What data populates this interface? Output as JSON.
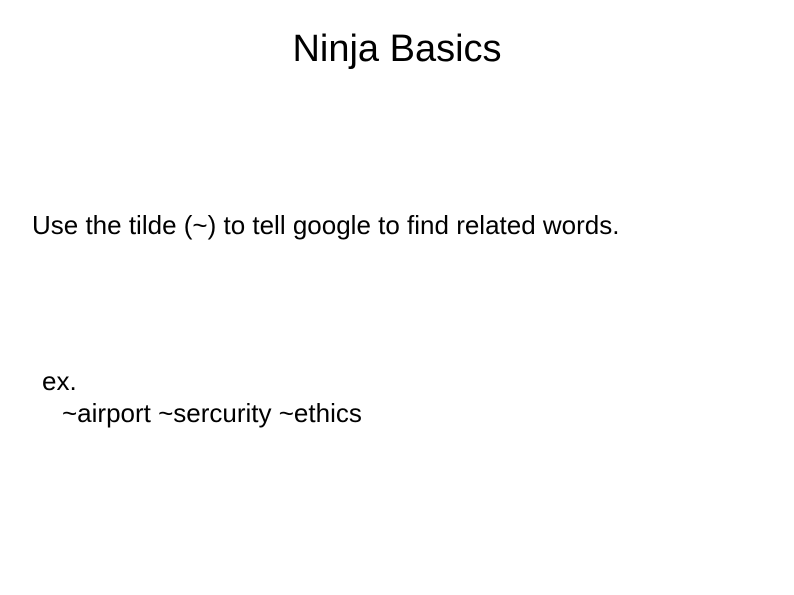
{
  "title": "Ninja Basics",
  "body_line": "Use the tilde (~) to tell google to find related words.",
  "example_label": "ex.",
  "example_text": "~airport ~sercurity ~ethics"
}
